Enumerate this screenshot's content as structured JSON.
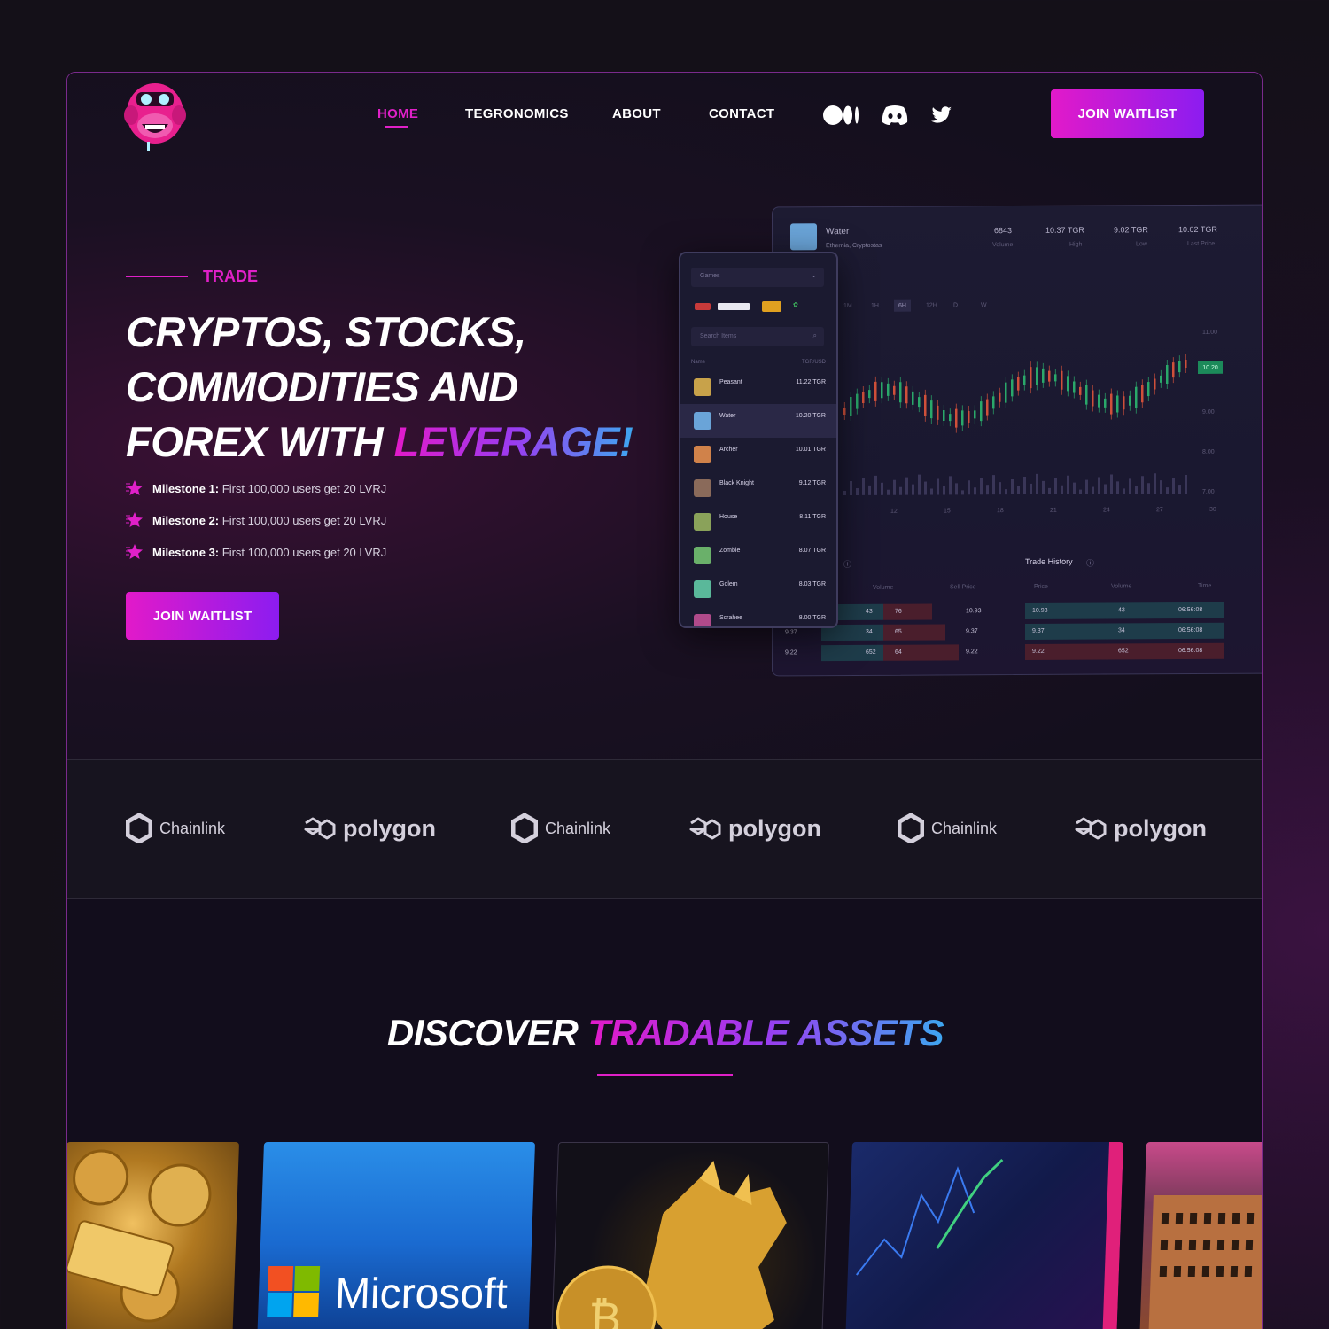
{
  "nav": {
    "items": [
      "HOME",
      "TEGRONOMICS",
      "ABOUT",
      "CONTACT"
    ],
    "active": "HOME",
    "join_label": "JOIN WAITLIST"
  },
  "social": [
    "medium-icon",
    "discord-icon",
    "twitter-icon"
  ],
  "hero": {
    "eyebrow": "TRADE",
    "headline_line1": "CRYPTOS, STOCKS,",
    "headline_line2": "COMMODITIES AND",
    "headline_line3_plain": "FOREX WITH ",
    "headline_line3_accent": "LEVERAGE!",
    "milestones": [
      {
        "label": "Milestone 1:",
        "text": "First 100,000 users get 20 LVRJ"
      },
      {
        "label": "Milestone 2:",
        "text": "First 100,000 users get 20 LVRJ"
      },
      {
        "label": "Milestone 3:",
        "text": "First 100,000 users get 20 LVRJ"
      }
    ],
    "cta_label": "JOIN WAITLIST"
  },
  "dashboard": {
    "asset_name": "Water",
    "asset_sub": "Ethernia, Cryptostas",
    "stats": [
      {
        "value": "6843",
        "label": "Volume"
      },
      {
        "value": "10.37 TGR",
        "label": "High"
      },
      {
        "value": "9.02 TGR",
        "label": "Low"
      },
      {
        "value": "10.02 TGR",
        "label": "Last Price"
      }
    ],
    "timeframes": [
      "1M",
      "1H",
      "6H",
      "12H",
      "D",
      "W"
    ],
    "price_ticks": [
      "11.00",
      "10.20",
      "9.00",
      "8.00",
      "7.00"
    ],
    "x_ticks": [
      "12",
      "15",
      "18",
      "21",
      "24",
      "27",
      "30"
    ],
    "last_price_tag": "10.20",
    "trade_history_title": "Trade History",
    "order_headers": [
      "Volume",
      "Sell Price"
    ],
    "history_headers": [
      "Price",
      "Volume",
      "Time"
    ],
    "orders": [
      {
        "price": "",
        "vol": "43",
        "v2": "76",
        "sell": "10.93"
      },
      {
        "price": "9.37",
        "vol": "34",
        "v2": "65",
        "sell": "9.37"
      },
      {
        "price": "9.22",
        "vol": "652",
        "v2": "64",
        "sell": "9.22"
      }
    ],
    "history": [
      {
        "price": "10.93",
        "vol": "43",
        "time": "06:56:08"
      },
      {
        "price": "9.37",
        "vol": "34",
        "time": "06:56:08"
      },
      {
        "price": "9.22",
        "vol": "652",
        "time": "06:56:08"
      }
    ]
  },
  "phone": {
    "dropdown": "Games",
    "search_placeholder": "Search Items",
    "col_name": "Name",
    "col_price": "TGR/USD",
    "items": [
      {
        "name": "Peasant",
        "price": "11.22 TGR",
        "color": "#c8a24a"
      },
      {
        "name": "Water",
        "price": "10.20 TGR",
        "color": "#6aa4d8"
      },
      {
        "name": "Archer",
        "price": "10.01 TGR",
        "color": "#d0824a"
      },
      {
        "name": "Black Knight",
        "price": "9.12 TGR",
        "color": "#8a6a5a"
      },
      {
        "name": "House",
        "price": "8.11 TGR",
        "color": "#8aa25a"
      },
      {
        "name": "Zombie",
        "price": "8.07 TGR",
        "color": "#6ab06a"
      },
      {
        "name": "Golem",
        "price": "8.03 TGR",
        "color": "#5ab89a"
      },
      {
        "name": "Scrahee",
        "price": "8.00 TGR",
        "color": "#b04a8a"
      }
    ]
  },
  "partners": [
    {
      "name": "Chainlink",
      "kind": "chain"
    },
    {
      "name": "polygon",
      "kind": "poly"
    },
    {
      "name": "Chainlink",
      "kind": "chain"
    },
    {
      "name": "polygon",
      "kind": "poly"
    },
    {
      "name": "Chainlink",
      "kind": "chain"
    },
    {
      "name": "polygon",
      "kind": "poly"
    }
  ],
  "discover": {
    "plain": "DISCOVER ",
    "accent": "TRADABLE ASSETS"
  },
  "cards": {
    "microsoft_label": "Microsoft"
  },
  "colors": {
    "accent": "#e020c8",
    "accent2": "#8c1cf0",
    "background": "#120d1c"
  }
}
